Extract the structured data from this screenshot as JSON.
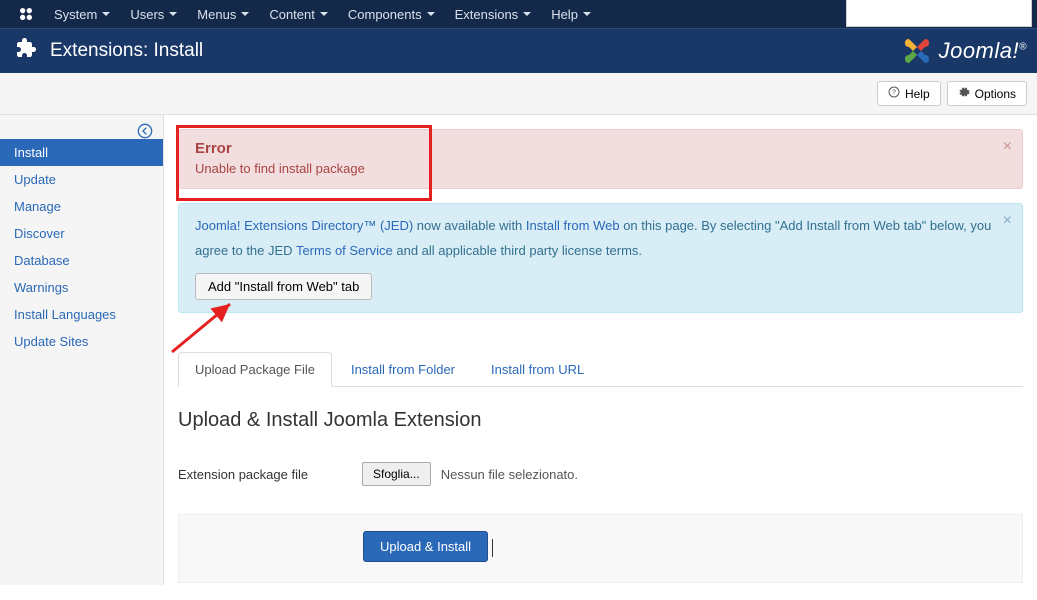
{
  "topnav": {
    "items": [
      {
        "label": "System"
      },
      {
        "label": "Users"
      },
      {
        "label": "Menus"
      },
      {
        "label": "Content"
      },
      {
        "label": "Components"
      },
      {
        "label": "Extensions"
      },
      {
        "label": "Help"
      }
    ]
  },
  "titlebar": {
    "title": "Extensions: Install",
    "brand": "Joomla!"
  },
  "toolbar": {
    "help_label": "Help",
    "options_label": "Options"
  },
  "sidebar": {
    "items": [
      {
        "label": "Install",
        "active": true
      },
      {
        "label": "Update"
      },
      {
        "label": "Manage"
      },
      {
        "label": "Discover"
      },
      {
        "label": "Database"
      },
      {
        "label": "Warnings"
      },
      {
        "label": "Install Languages"
      },
      {
        "label": "Update Sites"
      }
    ]
  },
  "alert_error": {
    "title": "Error",
    "message": "Unable to find install package"
  },
  "alert_info": {
    "link_jed": "Joomla! Extensions Directory™ (JED)",
    "text1": " now available with ",
    "link_install_web": "Install from Web",
    "text2": " on this page.    By selecting \"Add Install from Web tab\" below, you agree to the JED ",
    "link_tos": "Terms of Service",
    "text3": " and all applicable third party license terms.",
    "button": "Add \"Install from Web\" tab"
  },
  "tabs": {
    "items": [
      {
        "label": "Upload Package File",
        "active": true
      },
      {
        "label": "Install from Folder"
      },
      {
        "label": "Install from URL"
      }
    ]
  },
  "upload_section": {
    "title": "Upload & Install Joomla Extension",
    "field_label": "Extension package file",
    "browse_button": "Sfoglia...",
    "no_file_text": "Nessun file selezionato.",
    "submit_button": "Upload & Install"
  }
}
